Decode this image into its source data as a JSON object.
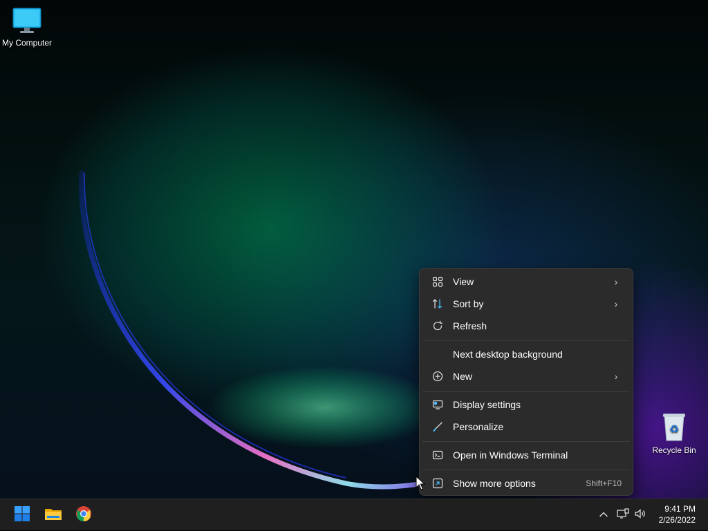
{
  "desktop": {
    "icons": [
      {
        "label": "My Computer",
        "icon": "monitor-icon"
      },
      {
        "label": "Recycle Bin",
        "icon": "recycle-bin-icon"
      }
    ]
  },
  "context_menu": {
    "items": [
      {
        "label": "View",
        "icon": "grid-icon",
        "submenu": true
      },
      {
        "label": "Sort by",
        "icon": "sort-icon",
        "submenu": true
      },
      {
        "label": "Refresh",
        "icon": "refresh-icon",
        "submenu": false
      },
      {
        "label": "Next desktop background",
        "icon": "",
        "submenu": false
      },
      {
        "label": "New",
        "icon": "plus-circle-icon",
        "submenu": true
      },
      {
        "label": "Display settings",
        "icon": "display-settings-icon",
        "submenu": false
      },
      {
        "label": "Personalize",
        "icon": "brush-icon",
        "submenu": false
      },
      {
        "label": "Open in Windows Terminal",
        "icon": "terminal-icon",
        "submenu": false
      },
      {
        "label": "Show more options",
        "icon": "more-options-icon",
        "submenu": false,
        "shortcut": "Shift+F10"
      }
    ],
    "submenu_arrow": "›"
  },
  "taskbar": {
    "pinned": [
      "start-button",
      "file-explorer",
      "chrome"
    ],
    "tray": {
      "chevron": "^",
      "time": "9:41 PM",
      "date": "2/26/2022"
    }
  },
  "colors": {
    "menu_bg": "#2b2b2b",
    "taskbar_bg": "#1f1f1f",
    "accent": "#0078d4"
  }
}
